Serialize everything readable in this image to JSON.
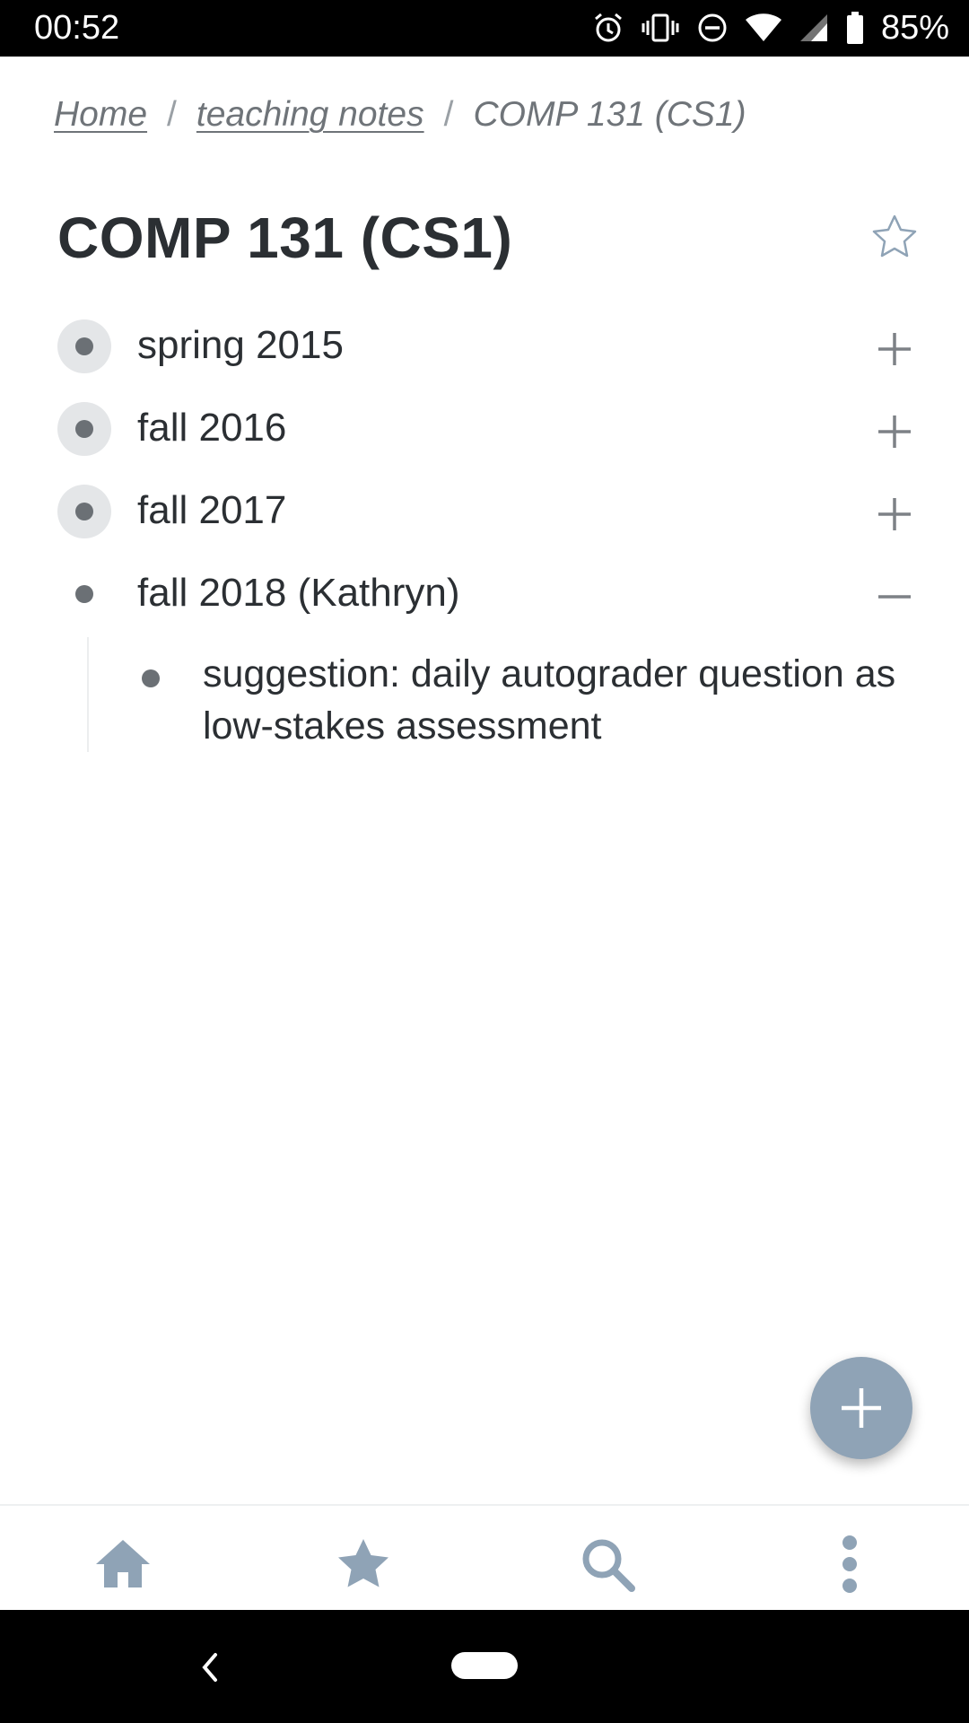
{
  "status_bar": {
    "time": "00:52",
    "battery": "85%",
    "icons": [
      "alarm-icon",
      "vibrate-icon",
      "do-not-disturb-icon",
      "wifi-icon",
      "cell-signal-icon",
      "battery-icon"
    ]
  },
  "breadcrumb": {
    "items": [
      {
        "label": "Home",
        "link": true
      },
      {
        "label": "teaching notes",
        "link": true
      },
      {
        "label": "COMP 131 (CS1)",
        "link": false
      }
    ],
    "separator": "/"
  },
  "page": {
    "title": "COMP 131 (CS1)",
    "favorite_icon": "star-outline-icon"
  },
  "outline": {
    "items": [
      {
        "label": "spring 2015",
        "state": "collapsed",
        "toggle_icon": "plus-icon"
      },
      {
        "label": "fall 2016",
        "state": "collapsed",
        "toggle_icon": "plus-icon"
      },
      {
        "label": "fall 2017",
        "state": "collapsed",
        "toggle_icon": "plus-icon"
      },
      {
        "label": "fall 2018 (Kathryn)",
        "state": "expanded",
        "toggle_icon": "minus-icon",
        "children": [
          {
            "label": "suggestion: daily autograder question as low-stakes assessment"
          }
        ]
      }
    ]
  },
  "fab": {
    "icon": "plus-icon"
  },
  "bottom_nav": {
    "items": [
      "home-icon",
      "star-icon",
      "search-icon",
      "more-vertical-icon"
    ]
  },
  "colors": {
    "accent": "#8fa3b6",
    "text": "#2b2f33",
    "muted": "#6f7479",
    "bullet": "#6b7075",
    "bullet_halo": "#e4e6e8"
  }
}
